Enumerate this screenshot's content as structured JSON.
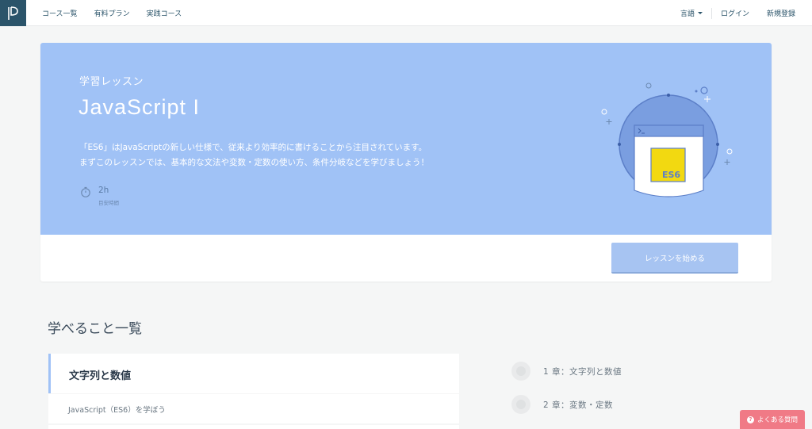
{
  "header": {
    "nav_left": [
      "コース一覧",
      "有料プラン",
      "実践コース"
    ],
    "language": "言語",
    "login": "ログイン",
    "signup": "新規登録"
  },
  "hero": {
    "subtitle": "学習レッスン",
    "title": "JavaScript I",
    "desc_line1": "「ES6」はJavaScriptの新しい仕様で、従来より効率的に書けることから注目されています。",
    "desc_line2": "まずこのレッスンでは、基本的な文法や変数・定数の使い方、条件分岐などを学びましょう！",
    "time_value": "2h",
    "time_label": "目安時間",
    "illust_badge": "ES6",
    "accent_color": "#a0c2f6"
  },
  "start_button": "レッスンを始める",
  "learnings": {
    "title": "学べること一覧",
    "chapter": {
      "name": "文字列と数値",
      "item": "JavaScript（ES6）を学ぼう"
    },
    "toc": [
      "1 章：文字列と数値",
      "2 章：変数・定数"
    ]
  },
  "faq": {
    "label": "よくある質問",
    "icon": "?"
  }
}
